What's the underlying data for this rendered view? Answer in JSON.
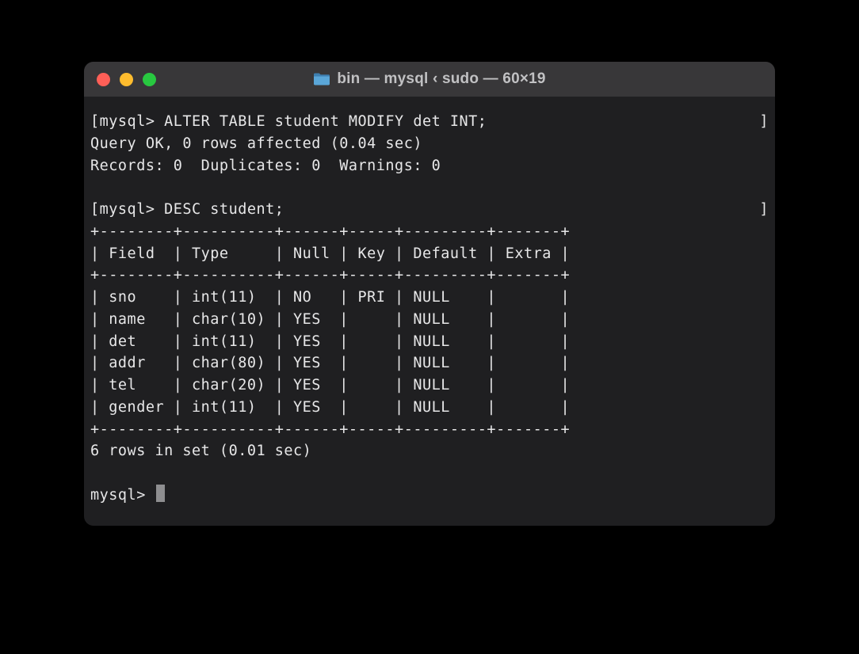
{
  "window": {
    "title": "bin — mysql ‹ sudo — 60×19"
  },
  "session": {
    "prompt1_open": "[",
    "prompt1_label": "mysql> ",
    "prompt1_cmd": "ALTER TABLE student MODIFY det INT;",
    "prompt1_close": "]",
    "result1_line1": "Query OK, 0 rows affected (0.04 sec)",
    "result1_line2": "Records: 0  Duplicates: 0  Warnings: 0",
    "prompt2_open": "[",
    "prompt2_label": "mysql> ",
    "prompt2_cmd": "DESC student;",
    "prompt2_close": "]",
    "table_border": "+--------+----------+------+-----+---------+-------+",
    "table_header": "| Field  | Type     | Null | Key | Default | Extra |",
    "rows": [
      "| sno    | int(11)  | NO   | PRI | NULL    |       |",
      "| name   | char(10) | YES  |     | NULL    |       |",
      "| det    | int(11)  | YES  |     | NULL    |       |",
      "| addr   | char(80) | YES  |     | NULL    |       |",
      "| tel    | char(20) | YES  |     | NULL    |       |",
      "| gender | int(11)  | YES  |     | NULL    |       |"
    ],
    "footer": "6 rows in set (0.01 sec)",
    "prompt3_label": "mysql> "
  }
}
